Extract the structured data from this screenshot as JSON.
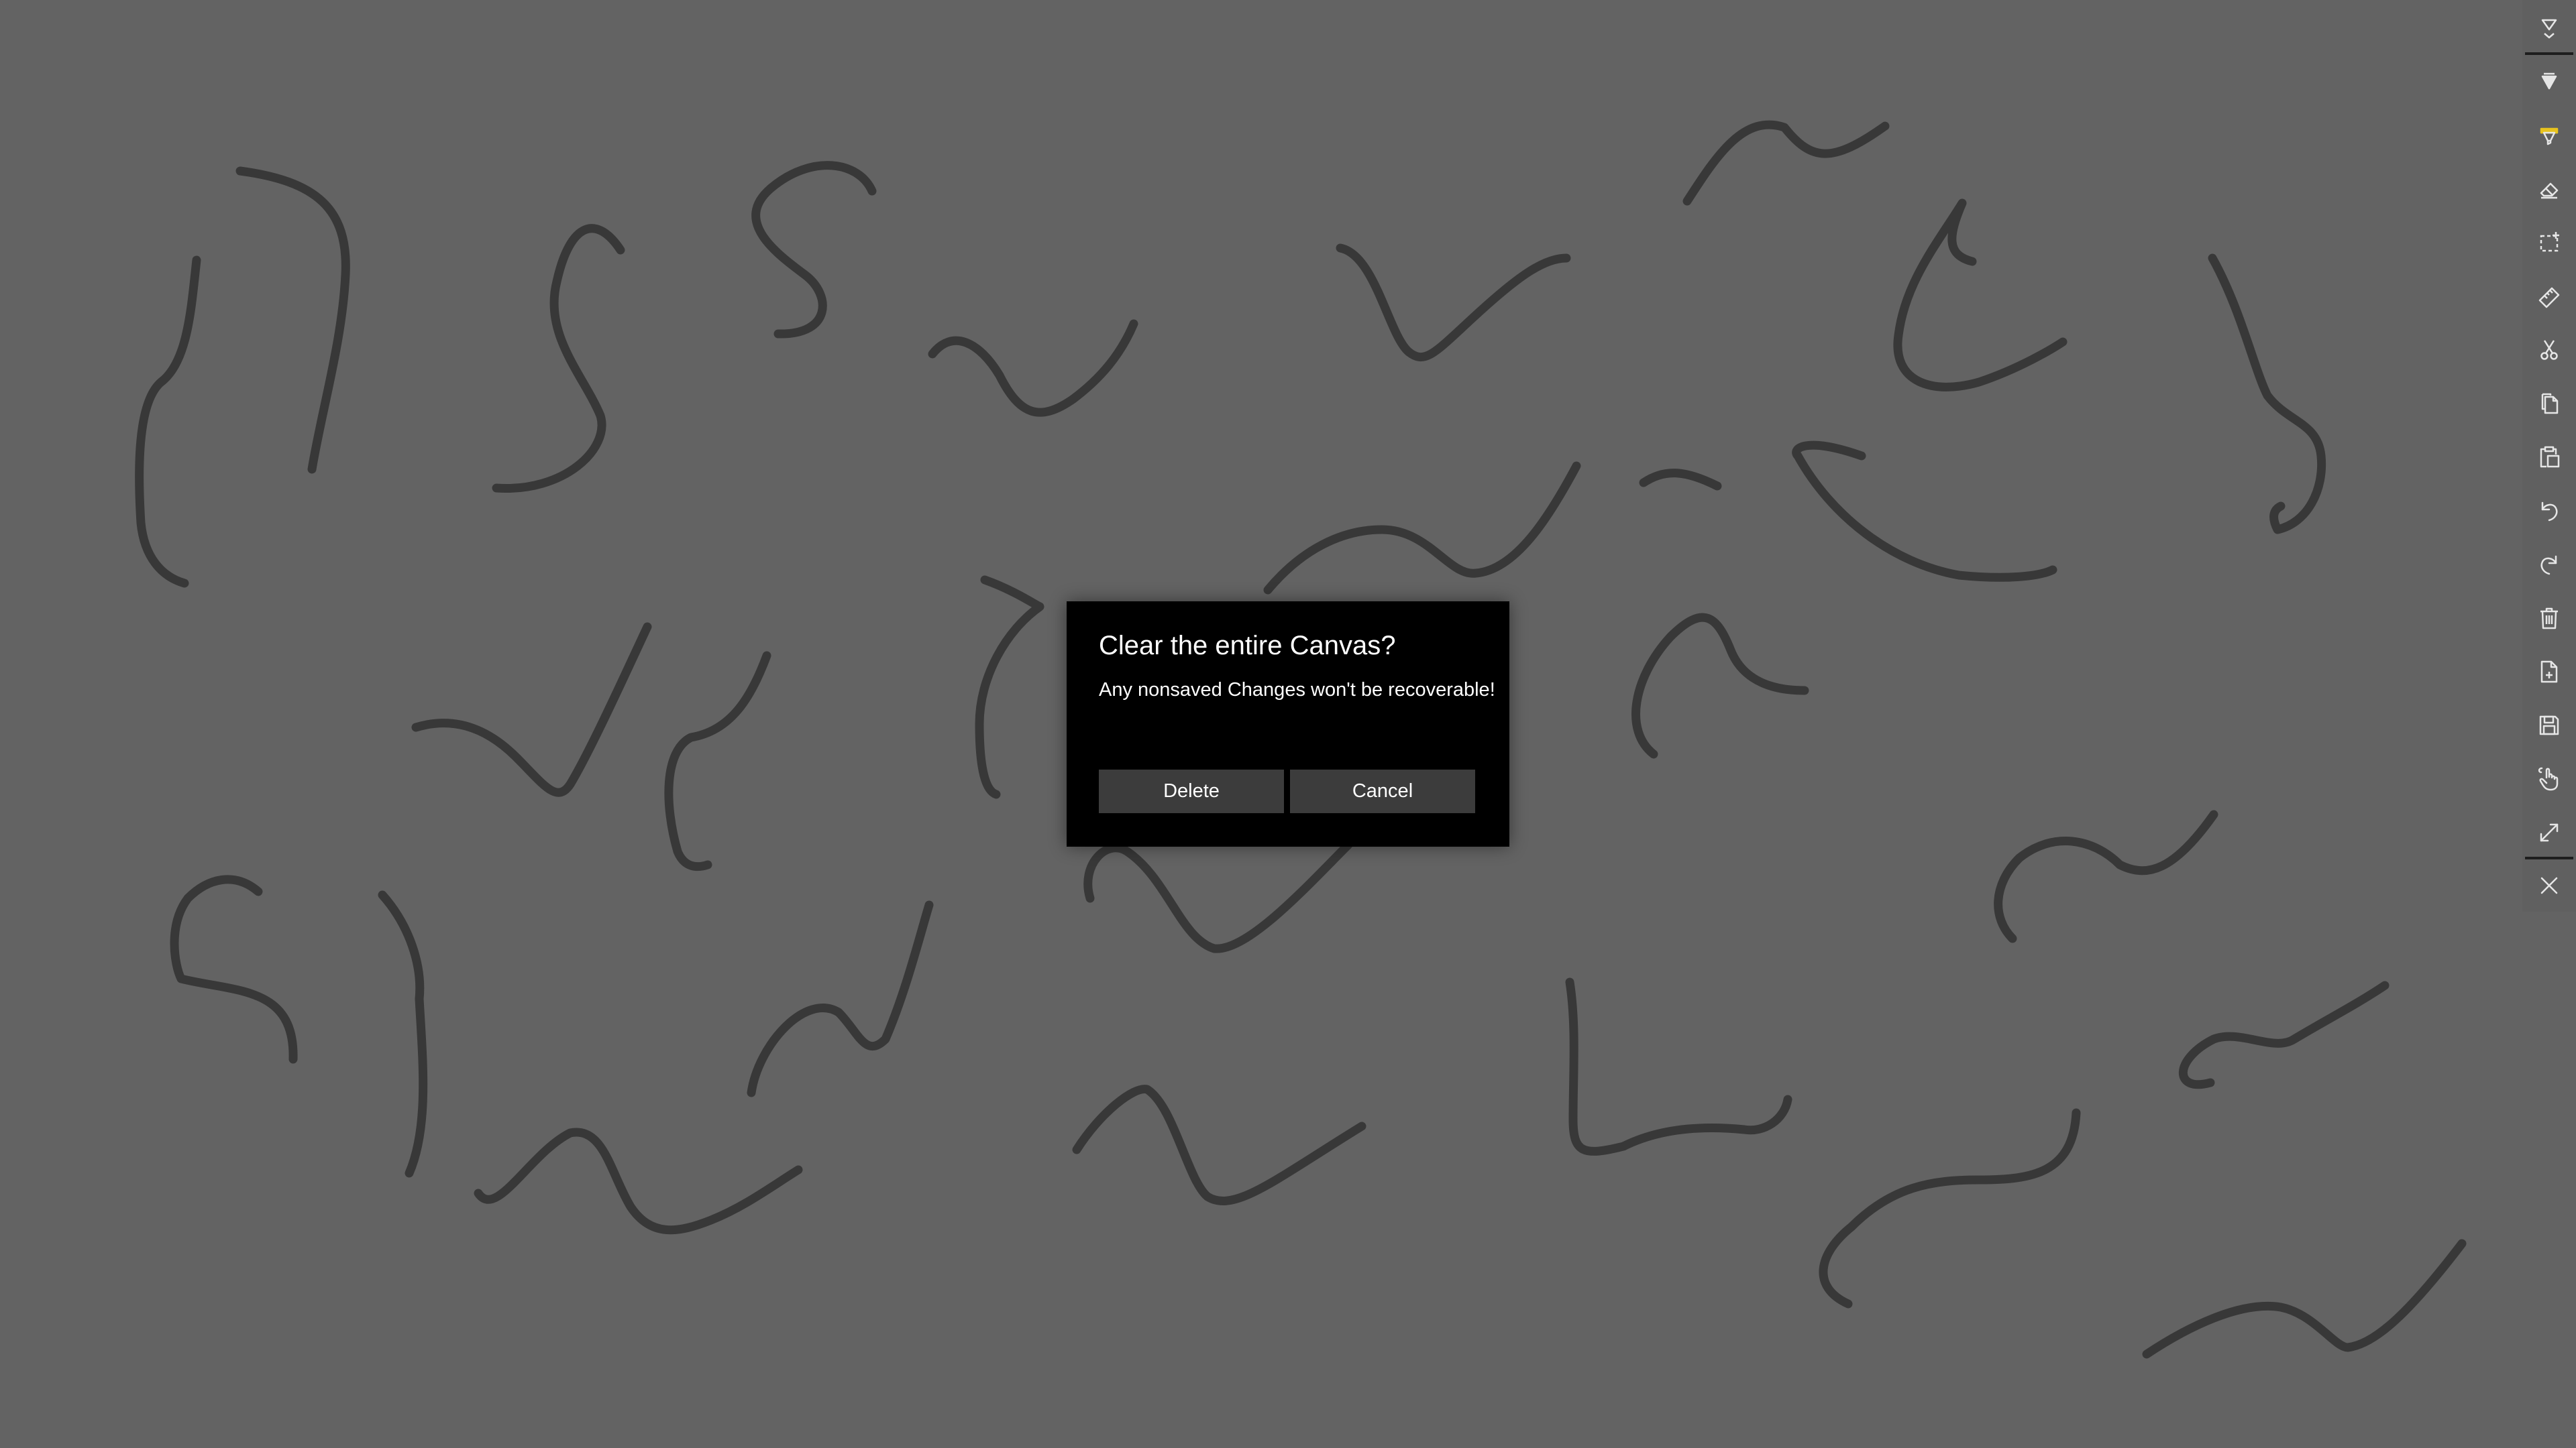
{
  "colors": {
    "canvas_background": "#636363",
    "ink_stroke": "#383838",
    "toolbar_icon": "#e6e6e6",
    "highlighter_accent": "#e8c31e",
    "dialog_background": "#000000",
    "dialog_button": "#3c3c3c",
    "dialog_text": "#ffffff"
  },
  "toolbar": {
    "items": [
      {
        "name": "collapse-toolbar-icon"
      },
      {
        "name": "pen-icon"
      },
      {
        "name": "highlighter-icon"
      },
      {
        "name": "eraser-icon"
      },
      {
        "name": "lasso-select-icon"
      },
      {
        "name": "ruler-icon"
      },
      {
        "name": "cut-icon"
      },
      {
        "name": "copy-icon"
      },
      {
        "name": "paste-icon"
      },
      {
        "name": "undo-icon"
      },
      {
        "name": "redo-icon"
      },
      {
        "name": "clear-canvas-icon"
      },
      {
        "name": "open-file-icon"
      },
      {
        "name": "save-icon"
      },
      {
        "name": "touch-writing-icon"
      },
      {
        "name": "fullscreen-icon"
      },
      {
        "name": "close-icon"
      }
    ]
  },
  "dialog": {
    "title": "Clear the entire Canvas?",
    "message": "Any nonsaved Changes won't be recoverable!",
    "primary_button": "Delete",
    "secondary_button": "Cancel"
  }
}
